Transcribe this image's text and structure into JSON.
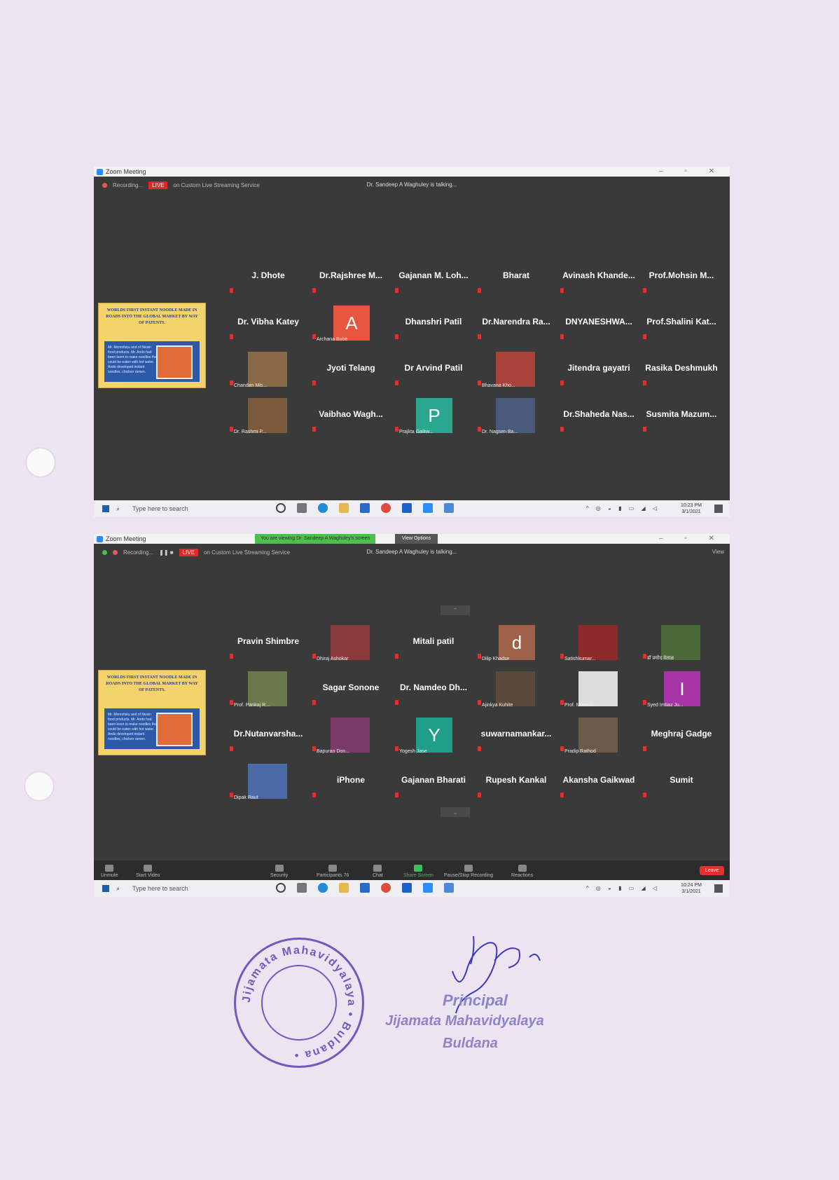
{
  "windows": [
    {
      "title": "Zoom Meeting",
      "recording_label": "Recording...",
      "live_label": "LIVE",
      "stream_label": "on Custom Live Streaming Service",
      "talking": "Dr. Sandeep A Waghuley is talking...",
      "share": {
        "headline": "WORLDS FIRST INSTANT NOODLE MADE IN ROADS INTO THE GLOBAL MARKET BY WAY OF PATENTS.",
        "body": "Mr. Momofuku and of Nissin food products. Mr. Ando had been keen to make noodles that could be eaten with hot water. Ando developed instant noodles, chicken ramen."
      },
      "participants": [
        {
          "name": "J. Dhote"
        },
        {
          "name": "Dr.Rajshree M..."
        },
        {
          "name": "Gajanan M. Loh..."
        },
        {
          "name": "Bharat"
        },
        {
          "name": "Avinash Khande..."
        },
        {
          "name": "Prof.Mohsin M..."
        },
        {
          "name": "Dr. Vibha Katey"
        },
        {
          "letter": "A",
          "color": "#e8553e",
          "sub": "Archana Bobe"
        },
        {
          "name": "Dhanshri Patil"
        },
        {
          "name": "Dr.Narendra Ra..."
        },
        {
          "name": "DNYANESHWA..."
        },
        {
          "name": "Prof.Shalini Kat..."
        },
        {
          "photo": "#8b6a4a",
          "sub": "Chandan Mis..."
        },
        {
          "name": "Jyoti Telang"
        },
        {
          "name": "Dr Arvind Patil"
        },
        {
          "photo": "#a8423a",
          "sub": "Bhavana Kho..."
        },
        {
          "name": "Jitendra gayatri"
        },
        {
          "name": "Rasika Deshmukh"
        },
        {
          "photo": "#7a5a3a",
          "sub": "Dr. Rashmi P..."
        },
        {
          "name": "Vaibhao Wagh..."
        },
        {
          "letter": "P",
          "color": "#2aa58e",
          "sub": "Prajkta Gaikw..."
        },
        {
          "photo": "#4a5a7a",
          "sub": "Dr. Nagsen Ba..."
        },
        {
          "name": "Dr.Shaheda Nas..."
        },
        {
          "name": "Susmita Mazum..."
        }
      ],
      "taskbar": {
        "search": "Type here to search",
        "time": "10:23 PM",
        "date": "3/1/2021"
      }
    },
    {
      "title": "Zoom Meeting",
      "viewing": "You are viewing Dr. Sandeep A Waghuley's screen",
      "view_options": "View Options",
      "recording_label": "Recording...",
      "live_label": "LIVE",
      "stream_label": "on Custom Live Streaming Service",
      "talking": "Dr. Sandeep A Waghuley is talking...",
      "view_btn": "View",
      "share": {
        "headline": "WORLDS FIRST INSTANT NOODLE MADE IN ROADS INTO THE GLOBAL MARKET BY WAY OF PATENTS.",
        "body": "Mr. Momofuku and of Nissin food products. Mr. Ando had been keen to make noodles that could be eaten with hot water. Ando developed instant noodles, chicken ramen."
      },
      "participants": [
        {
          "name": "Pravin Shimbre"
        },
        {
          "photo": "#8a3a3a",
          "sub": "Dhiraj Ashokar"
        },
        {
          "name": "Mitali patil"
        },
        {
          "letter": "d",
          "color": "#a0614a",
          "sub": "Dilip Khadse"
        },
        {
          "photo": "#8c2a2a",
          "sub": "Satishkumar..."
        },
        {
          "photo": "#4a6a3a",
          "sub": "डॉ प्रमोद वेताळ"
        },
        {
          "photo": "#6a7a4a",
          "sub": "Prof. Pankaj R..."
        },
        {
          "name": "Sagar Sonone"
        },
        {
          "name": "Dr. Namdeo Dh..."
        },
        {
          "photo": "#5a4a3a",
          "sub": "Ajinkya Kuhite"
        },
        {
          "photo": "#dcdcdc",
          "sub": "Prof. Munesh..."
        },
        {
          "letter": "I",
          "color": "#a634a6",
          "sub": "Syed Imtiaz Ju..."
        },
        {
          "name": "Dr.Nutanvarsha..."
        },
        {
          "photo": "#7a3a6a",
          "sub": "Bapurao Don..."
        },
        {
          "letter": "Y",
          "color": "#1f9e8a",
          "sub": "Yogesh Jase"
        },
        {
          "name": "suwarnamankar..."
        },
        {
          "photo": "#6a5a4a",
          "sub": "Pradip Rathod"
        },
        {
          "name": "Meghraj Gadge"
        },
        {
          "photo": "#4a6aa8",
          "sub": "Dipak Raut"
        },
        {
          "name": "iPhone"
        },
        {
          "name": "Gajanan Bharati"
        },
        {
          "name": "Rupesh Kankal"
        },
        {
          "name": "Akansha Gaikwad"
        },
        {
          "name": "Sumit"
        }
      ],
      "controls": {
        "unmute": "Unmute",
        "start_video": "Start Video",
        "security": "Security",
        "participants": "Participants",
        "participants_count": "76",
        "chat": "Chat",
        "share_screen": "Share Screen",
        "recording": "Pause/Stop Recording",
        "reactions": "Reactions",
        "leave": "Leave"
      },
      "taskbar": {
        "search": "Type here to search",
        "time": "10:24 PM",
        "date": "3/1/2021"
      }
    }
  ],
  "seal_text": "Jijamata Mahavidyalaya • Buldana •",
  "signature": {
    "title": "Principal",
    "institution": "Jijamata Mahavidyalaya",
    "place": "Buldana"
  }
}
